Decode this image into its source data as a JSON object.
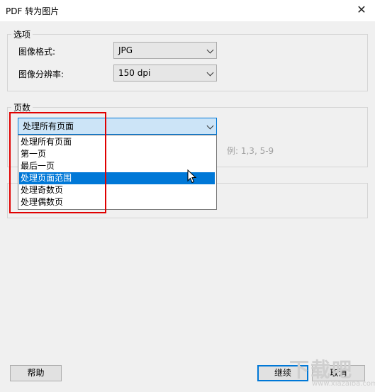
{
  "window": {
    "title": "PDF 转为图片",
    "close_glyph": "✕"
  },
  "options_group": {
    "legend": "选项",
    "format_label": "图像格式:",
    "format_value": "JPG",
    "resolution_label": "图像分辨率:",
    "resolution_value": "150 dpi"
  },
  "pages_group": {
    "legend": "页数",
    "selected": "处理所有页面",
    "options": [
      "处理所有页面",
      "第一页",
      "最后一页",
      "处理页面范围",
      "处理奇数页",
      "处理偶数页"
    ],
    "highlighted_index": 3,
    "range_hint": "例: 1,3, 5-9"
  },
  "buttons": {
    "help": "帮助",
    "continue": "继续",
    "cancel": "取消"
  },
  "watermark": {
    "text": "下载吧",
    "url": "www.xiazaiba.com"
  },
  "colors": {
    "accent": "#0078d7",
    "highlight_box": "#e00000"
  },
  "icons": {
    "close": "close-icon",
    "dropdown": "chevron-down-icon",
    "cursor": "mouse-pointer-icon"
  }
}
